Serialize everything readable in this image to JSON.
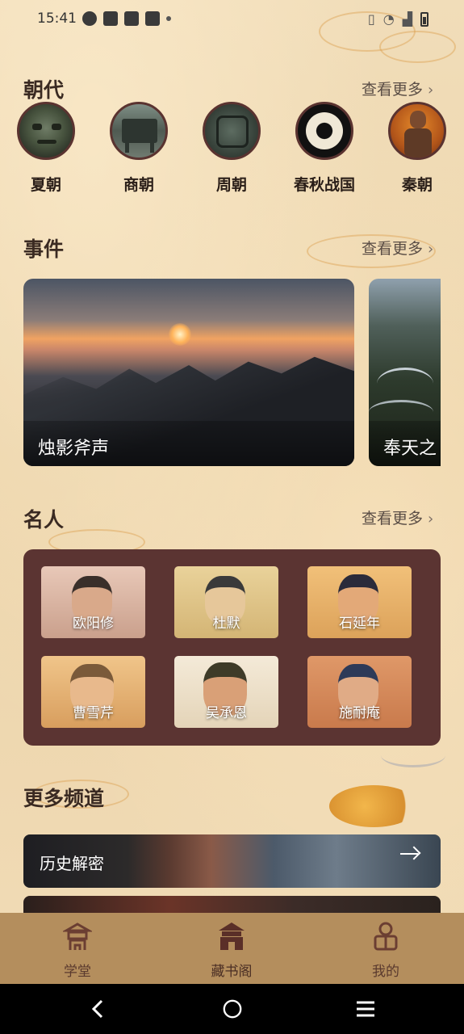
{
  "status_bar": {
    "time": "15:41"
  },
  "sections": {
    "dynasty": {
      "title": "朝代",
      "more": "查看更多"
    },
    "events": {
      "title": "事件",
      "more": "查看更多"
    },
    "people": {
      "title": "名人",
      "more": "查看更多"
    },
    "channels": {
      "title": "更多频道"
    }
  },
  "dynasties": [
    {
      "label": "夏朝",
      "icon": "bronze-mask-icon"
    },
    {
      "label": "商朝",
      "icon": "bronze-ding-icon"
    },
    {
      "label": "周朝",
      "icon": "bronze-vessel-icon"
    },
    {
      "label": "春秋战国",
      "icon": "jade-bi-icon"
    },
    {
      "label": "秦朝",
      "icon": "terracotta-warrior-icon"
    }
  ],
  "events": [
    {
      "title": "烛影斧声"
    },
    {
      "title": "奉天之"
    }
  ],
  "people": [
    {
      "name": "欧阳修"
    },
    {
      "name": "杜默"
    },
    {
      "name": "石延年"
    },
    {
      "name": "曹雪芹"
    },
    {
      "name": "吴承恩"
    },
    {
      "name": "施耐庵"
    }
  ],
  "channels": [
    {
      "title": "历史解密"
    },
    {
      "title": ""
    }
  ],
  "bottom_nav": [
    {
      "label": "学堂",
      "icon": "pavilion-icon"
    },
    {
      "label": "藏书阁",
      "icon": "library-icon"
    },
    {
      "label": "我的",
      "icon": "profile-icon"
    }
  ],
  "colors": {
    "background": "#f0dcb7",
    "panel": "#5b3432",
    "nav_bar": "#b48e5d",
    "accent_cloud": "#e39a2e"
  }
}
